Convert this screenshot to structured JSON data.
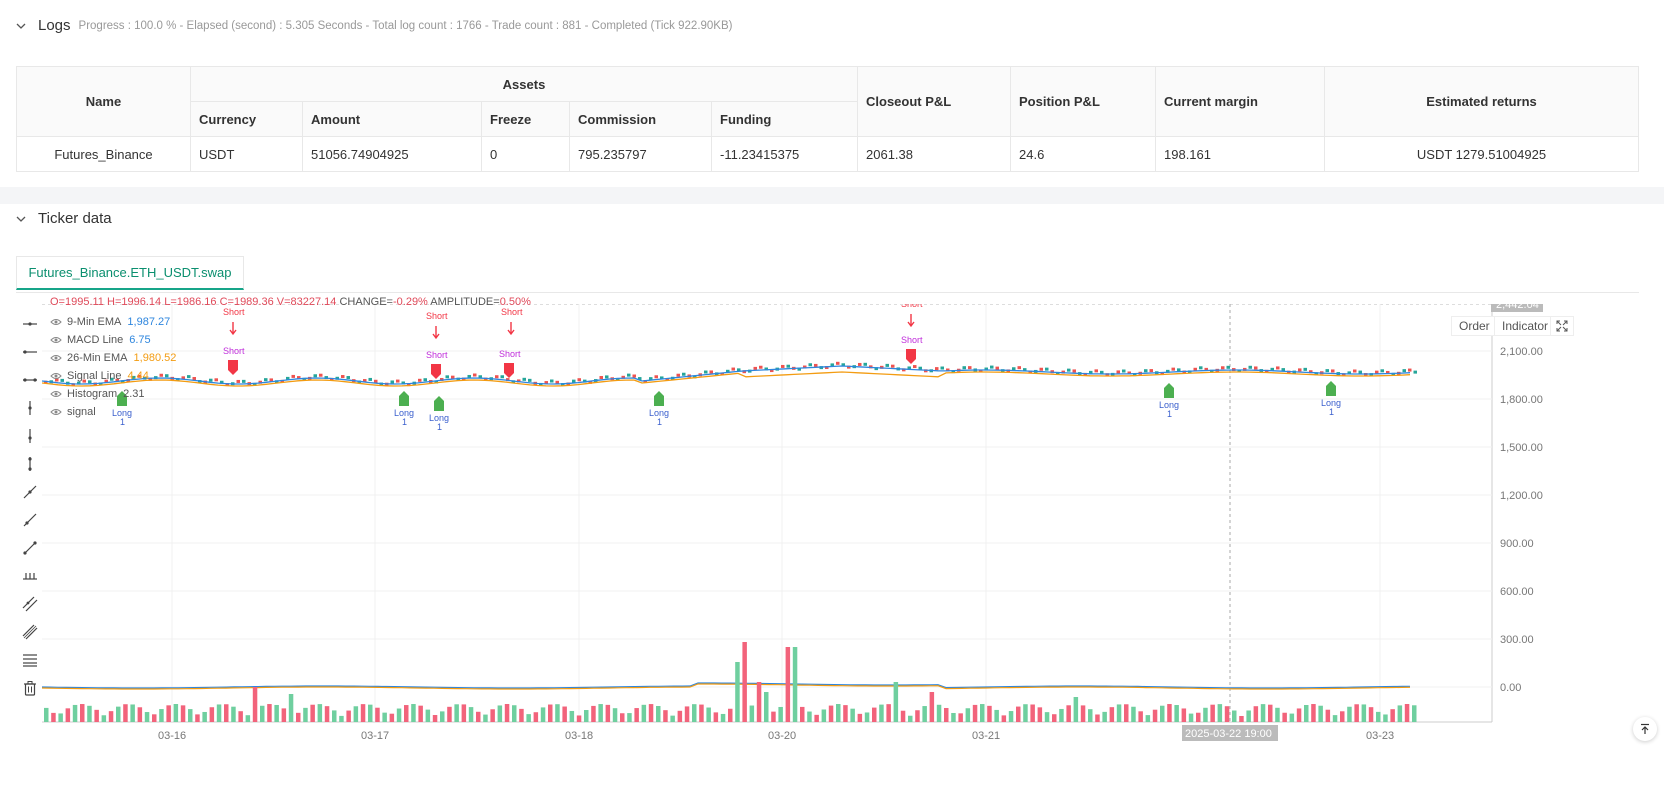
{
  "logs": {
    "title": "Logs",
    "summary": "Progress : 100.0 % - Elapsed (second) : 5.305  Seconds - Total log count : 1766 - Trade count : 881 - Completed (Tick 922.90KB)"
  },
  "assets_table": {
    "headers": {
      "name": "Name",
      "assets": "Assets",
      "currency": "Currency",
      "amount": "Amount",
      "freeze": "Freeze",
      "commission": "Commission",
      "funding": "Funding",
      "closeout": "Closeout P&L",
      "position": "Position P&L",
      "margin": "Current margin",
      "returns": "Estimated returns"
    },
    "row": {
      "name": "Futures_Binance",
      "currency": "USDT",
      "amount": "51056.74904925",
      "freeze": "0",
      "commission": "795.235797",
      "funding": "-11.23415375",
      "closeout": "2061.38",
      "position": "24.6",
      "margin": "198.161",
      "returns": "USDT 1279.51004925"
    }
  },
  "ticker": {
    "title": "Ticker data",
    "tab": "Futures_Binance.ETH_USDT.swap",
    "buttons": {
      "order": "Order",
      "indicator": "Indicator"
    },
    "ohlc": {
      "o": "O=1995.11",
      "h": "H=1996.14",
      "l": "L=1986.16",
      "c": "C=1989.36",
      "v": "V=83227.14",
      "change_label": "CHANGE=",
      "change": "-0.29%",
      "amp_label": "AMPLITUDE=",
      "amp": "0.50%"
    },
    "legend": [
      {
        "name": "9-Min EMA",
        "value": "1,987.27",
        "color": "#2e86de"
      },
      {
        "name": "MACD Line",
        "value": "6.75",
        "color": "#2e86de"
      },
      {
        "name": "26-Min EMA",
        "value": "1,980.52",
        "color": "#f39c12"
      },
      {
        "name": "Signal Line",
        "value": "4.44",
        "color": "#f39c12"
      },
      {
        "name": "Histogram",
        "value": "2.31",
        "color": "#555"
      },
      {
        "name": "signal",
        "value": "",
        "color": "#555"
      }
    ],
    "crosshair_price": "2,442.04",
    "crosshair_time": "2025-03-22 19:00"
  },
  "chart_data": {
    "type": "candlestick",
    "y_ticks": [
      "2,100.00",
      "1,800.00",
      "1,500.00",
      "1,200.00",
      "900.00",
      "600.00",
      "300.00",
      "0.00"
    ],
    "x_ticks": [
      "03-16",
      "03-17",
      "03-18",
      "03-20",
      "03-21",
      "03-23"
    ],
    "series_colors": {
      "up": "#26a69a",
      "down": "#ef5350",
      "ema_fast": "#2e86de",
      "ema_slow": "#f39c12",
      "long": "#4caf50",
      "short": "#f23645"
    },
    "signals": [
      {
        "type": "Long",
        "label": "Long"
      },
      {
        "type": "Short",
        "label": "Short"
      },
      {
        "type": "Long",
        "label": "Long"
      },
      {
        "type": "Long",
        "label": "Long"
      },
      {
        "type": "Short",
        "label": "Short"
      },
      {
        "type": "Long",
        "label": "Long"
      },
      {
        "type": "Short",
        "label": "Short"
      },
      {
        "type": "Long",
        "label": "Long"
      },
      {
        "type": "Short",
        "label": "Short"
      },
      {
        "type": "Long",
        "label": "Long"
      }
    ],
    "signal_count_label": "1"
  }
}
